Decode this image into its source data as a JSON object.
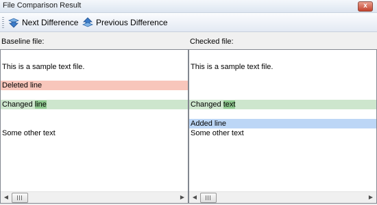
{
  "window": {
    "title": "File Comparison Result",
    "close_glyph": "x"
  },
  "toolbar": {
    "next_label": "Next Difference",
    "next_icon": "arrow-down-icon",
    "prev_label": "Previous Difference",
    "prev_icon": "arrow-up-icon"
  },
  "baseline": {
    "label": "Baseline file:",
    "line1": "This is a sample text file.",
    "deleted": "Deleted line",
    "changed_prefix": "Changed ",
    "changed_diff": "line",
    "other": "Some other text"
  },
  "checked": {
    "label": "Checked file:",
    "line1": "This is a sample text file.",
    "changed_prefix": "Changed ",
    "changed_diff": "text",
    "added": "Added line",
    "other": "Some other text"
  },
  "colors": {
    "deleted": "#f8c6bb",
    "changed": "#cde6cd",
    "changed_word": "#8fc98f",
    "added": "#bcd6f6"
  }
}
